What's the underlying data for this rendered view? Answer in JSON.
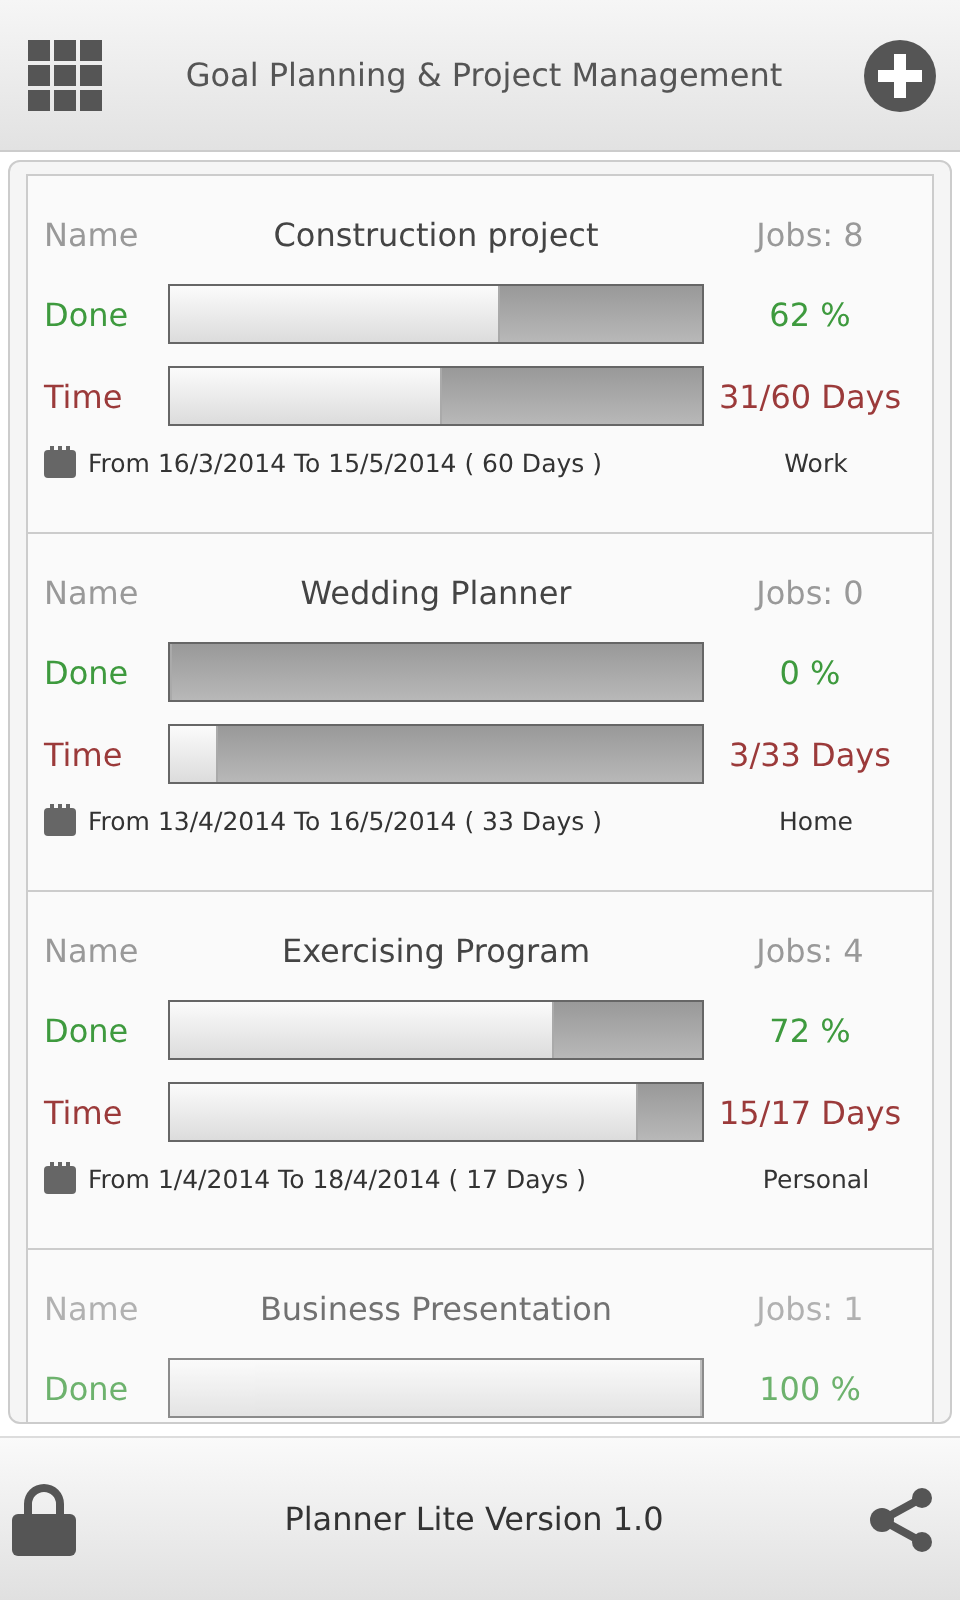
{
  "header": {
    "title": "Goal Planning & Project Management"
  },
  "projects": [
    {
      "name_label": "Name",
      "name": "Construction project",
      "jobs": "Jobs: 8",
      "faded": false,
      "done": {
        "label": "Done",
        "level": 0.62,
        "reading": "62 %"
      },
      "time": {
        "label": "Time",
        "level": 0.51,
        "reading": "31/60 Days"
      },
      "dates": "From 16/3/2014 To 15/5/2014  ( 60 Days )",
      "category": "Work"
    },
    {
      "name_label": "Name",
      "name": "Wedding Planner",
      "jobs": "Jobs: 0",
      "faded": false,
      "done": {
        "label": "Done",
        "level": 0,
        "reading": "0 %"
      },
      "time": {
        "label": "Time",
        "level": 0.09,
        "reading": "3/33 Days"
      },
      "dates": "From 13/4/2014 To 16/5/2014  ( 33 Days )",
      "category": "Home"
    },
    {
      "name_label": "Name",
      "name": "Exercising Program",
      "jobs": "Jobs: 4",
      "faded": false,
      "done": {
        "label": "Done",
        "level": 0.72,
        "reading": "72 %"
      },
      "time": {
        "label": "Time",
        "level": 0.88,
        "reading": "15/17 Days"
      },
      "dates": "From 1/4/2014 To 18/4/2014  ( 17 Days )",
      "category": "Personal"
    },
    {
      "name_label": "Name",
      "name": "Business Presentation",
      "jobs": "Jobs: 1",
      "faded": true,
      "done": {
        "label": "Done",
        "level": 1,
        "reading": "100 %"
      }
    }
  ],
  "footer": {
    "title": "Planner Lite Version 1.0"
  }
}
